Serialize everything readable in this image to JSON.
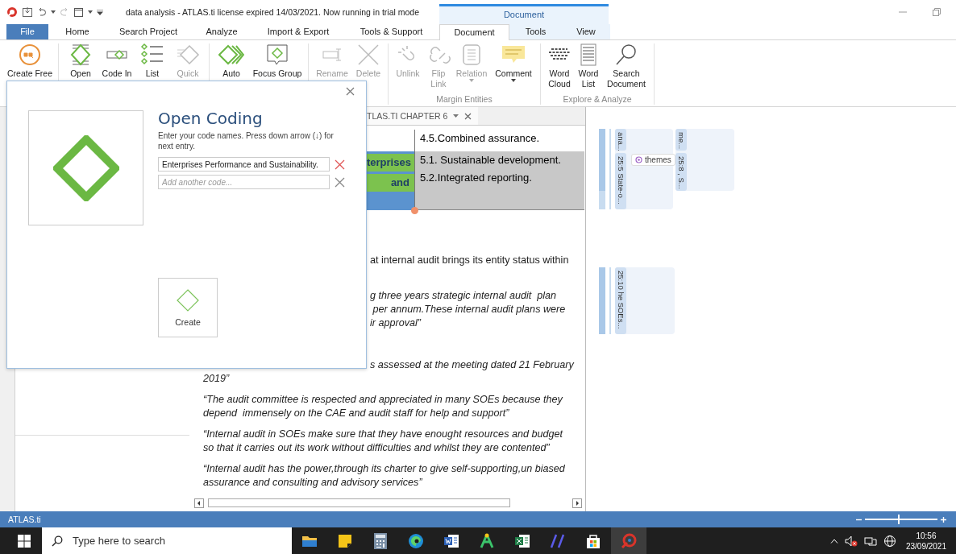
{
  "window": {
    "title": "data analysis - ATLAS.ti license expired 14/03/2021. Now running in trial mode",
    "context_group": "Document"
  },
  "tabs": [
    {
      "label": "File",
      "kind": "file",
      "selected": false
    },
    {
      "label": "Home",
      "kind": "plain",
      "selected": false
    },
    {
      "label": "Search Project",
      "kind": "plain",
      "selected": false
    },
    {
      "label": "Analyze",
      "kind": "plain",
      "selected": false
    },
    {
      "label": "Import & Export",
      "kind": "plain",
      "selected": false
    },
    {
      "label": "Tools & Support",
      "kind": "plain",
      "selected": false
    },
    {
      "label": "Document",
      "kind": "context",
      "selected": true
    },
    {
      "label": "Tools",
      "kind": "context",
      "selected": false
    },
    {
      "label": "View",
      "kind": "context",
      "selected": false
    }
  ],
  "ribbon": {
    "groups": [
      {
        "buttons": [
          {
            "lines": [
              "Create Free"
            ],
            "kind": "quote",
            "disabled": false
          }
        ]
      },
      {
        "buttons": [
          {
            "lines": [
              "Open"
            ],
            "kind": "coding",
            "disabled": false
          },
          {
            "lines": [
              "Code In"
            ],
            "kind": "invivo",
            "disabled": false
          },
          {
            "lines": [
              "List"
            ],
            "kind": "list",
            "disabled": false
          },
          {
            "lines": [
              "Quick"
            ],
            "kind": "quick",
            "disabled": true
          }
        ]
      },
      {
        "buttons": [
          {
            "lines": [
              "Auto"
            ],
            "kind": "auto",
            "disabled": false
          },
          {
            "lines": [
              "Focus Group"
            ],
            "kind": "focus",
            "disabled": false
          }
        ]
      },
      {
        "buttons": [
          {
            "lines": [
              "Rename"
            ],
            "kind": "rename",
            "disabled": true
          },
          {
            "lines": [
              "Delete"
            ],
            "kind": "delete",
            "disabled": true
          }
        ]
      },
      {
        "label": "Margin Entities",
        "buttons": [
          {
            "lines": [
              "Unlink"
            ],
            "kind": "unlink",
            "disabled": true
          },
          {
            "lines": [
              "Flip",
              "Link"
            ],
            "kind": "flip",
            "disabled": true
          },
          {
            "lines": [
              "Relation"
            ],
            "kind": "relation",
            "disabled": true,
            "menu": true
          },
          {
            "lines": [
              "Comment"
            ],
            "kind": "comment",
            "disabled": false,
            "menu": true
          }
        ]
      },
      {
        "label": "Explore & Analyze",
        "buttons": [
          {
            "lines": [
              "Word",
              "Cloud"
            ],
            "kind": "cloud",
            "disabled": false
          },
          {
            "lines": [
              "Word",
              "List"
            ],
            "kind": "wordlist",
            "disabled": false
          },
          {
            "lines": [
              "Search",
              "Document"
            ],
            "kind": "search",
            "disabled": false
          }
        ]
      }
    ]
  },
  "document": {
    "tab": {
      "label": "TLAS.TI CHAPTER 6"
    },
    "table": {
      "rows": [
        {
          "selected": false,
          "column_2": [
            "4.5.Combined assurance."
          ]
        },
        {
          "selected": true,
          "column_1": [
            "terprises",
            "and"
          ],
          "column_2": [
            "5.1. Sustainable development.",
            "5.2.Integrated reporting."
          ]
        }
      ]
    },
    "paragraphs": [
      {
        "italic": false,
        "lines": [
          {
            "text": "at internal audit brings its entity status within",
            "cut": true
          }
        ]
      },
      {
        "italic": true,
        "lines": [
          {
            "text": "g three years strategic internal audit  plan",
            "cut": true
          },
          {
            "text": " per annum.These internal audit plans were",
            "cut": true
          },
          {
            "text": "ir approval”",
            "cut": true
          }
        ]
      },
      {
        "italic": true,
        "lines": [
          {
            "text": "s assessed at the meeting dated 21 February",
            "cut": true
          },
          {
            "text": "2019”",
            "cut": false
          }
        ]
      },
      {
        "italic": true,
        "lines": [
          {
            "text": "“The audit committee is respected and appreciated in many SOEs because they",
            "cut": false
          },
          {
            "text": "depend  immensely on the CAE and audit staff for help and support”",
            "cut": false
          }
        ]
      },
      {
        "italic": true,
        "lines": [
          {
            "text": "“Internal audit in SOEs make sure that they have enought resources and budget",
            "cut": false
          },
          {
            "text": "so that it carries out its work without difficulties and whilst they are contented”",
            "cut": false
          }
        ]
      },
      {
        "italic": true,
        "lines": [
          {
            "text": "“Internal audit has the power,through its charter to give self-supporting,un biased",
            "cut": false
          },
          {
            "text": "assurance and consulting and advisory services”",
            "cut": false
          }
        ]
      }
    ]
  },
  "margin": {
    "codes": [
      {
        "label": "ana..."
      },
      {
        "label": "25:5 State-o..."
      },
      {
        "label": "me..."
      },
      {
        "label": "25:8 , S..."
      },
      {
        "label": "25:10 he SOEs..."
      }
    ],
    "tags": [
      {
        "label": "themes"
      }
    ]
  },
  "dialog": {
    "title": "Open Coding",
    "instructions": "Enter your code names. Press down arrow (↓) for next entry.",
    "codes": [
      {
        "value": "Enterprises Performance and Sustainability."
      },
      {
        "placeholder": "Add another code..."
      }
    ],
    "create_button": "Create"
  },
  "status_bar": {
    "text": "ATLAS.ti",
    "zoom": {
      "level": 0.45
    }
  },
  "taskbar": {
    "search": {
      "placeholder": "Type here to search"
    },
    "apps": [
      {
        "kind": "folder",
        "selected": false
      },
      {
        "kind": "notes",
        "selected": false
      },
      {
        "kind": "calculator",
        "selected": false
      },
      {
        "kind": "browser",
        "selected": false
      },
      {
        "kind": "word",
        "selected": false
      },
      {
        "kind": "tree",
        "selected": false
      },
      {
        "kind": "excel",
        "selected": false
      },
      {
        "kind": "slashes",
        "selected": false
      },
      {
        "kind": "store",
        "selected": false
      },
      {
        "kind": "atlas",
        "selected": true
      }
    ],
    "clock": {
      "time": "10:56",
      "date": "23/09/2021"
    }
  }
}
